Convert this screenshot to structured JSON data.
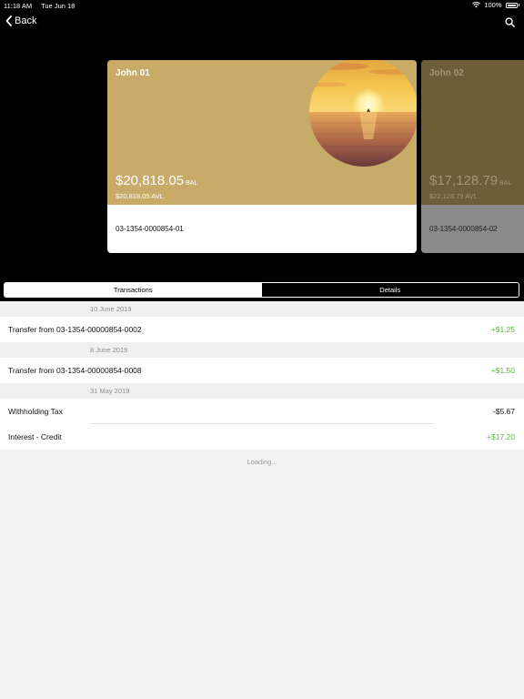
{
  "status_bar": {
    "time": "11:18 AM",
    "date": "Tue Jun 18",
    "battery": "100%"
  },
  "nav": {
    "back_label": "Back"
  },
  "cards": [
    {
      "name": "John 01",
      "balance": "$20,818.05",
      "bal_tag": "BAL",
      "available": "$20,818.05 AVL",
      "account": "03-1354-0000854-01"
    },
    {
      "name": "John 02",
      "balance": "$17,128.79",
      "bal_tag": "BAL",
      "available": "$22,128.79 AVL",
      "account": "03-1354-0000854-02"
    }
  ],
  "tabs": [
    {
      "label": "Transactions"
    },
    {
      "label": "Details"
    }
  ],
  "groups": [
    {
      "date": "10 June 2019",
      "items": [
        {
          "description": "Transfer from 03-1354-00000854-0002",
          "amount": "+$1.25"
        }
      ]
    },
    {
      "date": "8 June 2019",
      "items": [
        {
          "description": "Transfer from 03-1354-00000854-0008",
          "amount": "+$1.50"
        }
      ]
    },
    {
      "date": "31 May 2019",
      "items": [
        {
          "description": "Withholding Tax",
          "amount": "-$5.67"
        },
        {
          "description": "Interest - Credit",
          "amount": "+$17.20"
        }
      ]
    }
  ],
  "loading_text": "Loading...",
  "colors": {
    "card_gold": "#c9ab69",
    "positive_amount": "#5cb83a",
    "background": "#f2f2f2"
  }
}
